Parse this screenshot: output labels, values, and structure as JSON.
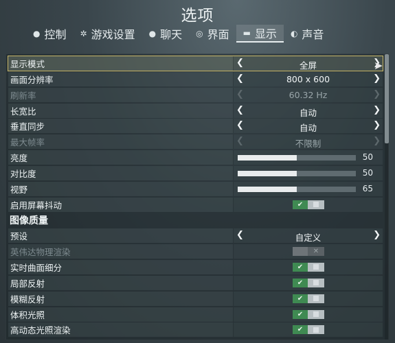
{
  "title": "选项",
  "tabs": [
    {
      "icon": "mouse-icon",
      "glyph": "●",
      "label": "控制"
    },
    {
      "icon": "gear-icon",
      "glyph": "✲",
      "label": "游戏设置"
    },
    {
      "icon": "chat-bubble-icon",
      "glyph": "●",
      "label": "聊天"
    },
    {
      "icon": "interface-icon",
      "glyph": "◎",
      "label": "界面"
    },
    {
      "icon": "monitor-icon",
      "glyph": "▬",
      "label": "显示"
    },
    {
      "icon": "speaker-icon",
      "glyph": "◐",
      "label": "声音"
    }
  ],
  "active_tab": "显示",
  "rows": [
    {
      "label": "显示模式",
      "type": "select",
      "value": "全屏"
    },
    {
      "label": "画面分辨率",
      "type": "select",
      "value": "800 x 600"
    },
    {
      "label": "刷新率",
      "type": "select",
      "value": "60.32 Hz"
    },
    {
      "label": "长宽比",
      "type": "select",
      "value": "自动"
    },
    {
      "label": "垂直同步",
      "type": "select",
      "value": "自动"
    },
    {
      "label": "最大帧率",
      "type": "select",
      "value": "不限制"
    },
    {
      "label": "亮度",
      "type": "slider",
      "value": "50",
      "level": 0.5
    },
    {
      "label": "对比度",
      "type": "slider",
      "value": "50",
      "level": 0.5
    },
    {
      "label": "视野",
      "type": "slider",
      "value": "65",
      "level": 0.5
    },
    {
      "label": "启用屏幕抖动",
      "type": "toggle",
      "on_glyph": "✔",
      "checked": true
    },
    {
      "label": "图像质量",
      "type": "section"
    },
    {
      "label": "预设",
      "type": "select",
      "value": "自定义"
    },
    {
      "label": "英伟达物理渲染",
      "type": "toggle",
      "off_glyph": "✕",
      "checked": false
    },
    {
      "label": "实时曲面细分",
      "type": "toggle",
      "on_glyph": "✔",
      "checked": true
    },
    {
      "label": "局部反射",
      "type": "toggle",
      "on_glyph": "✔",
      "checked": true
    },
    {
      "label": "模糊反射",
      "type": "toggle",
      "on_glyph": "✔",
      "checked": true
    },
    {
      "label": "体积光照",
      "type": "toggle",
      "on_glyph": "✔",
      "checked": true
    },
    {
      "label": "高动态光照渲染",
      "type": "toggle",
      "on_glyph": "✔",
      "checked": true
    }
  ],
  "arrow_left": "❮",
  "arrow_right": "❯",
  "cursor_glyph": "➤",
  "colors": {
    "accent_selected": "#c9b86a",
    "toggle_on": "#3f8a52",
    "slider_fill": "#e9eced"
  }
}
